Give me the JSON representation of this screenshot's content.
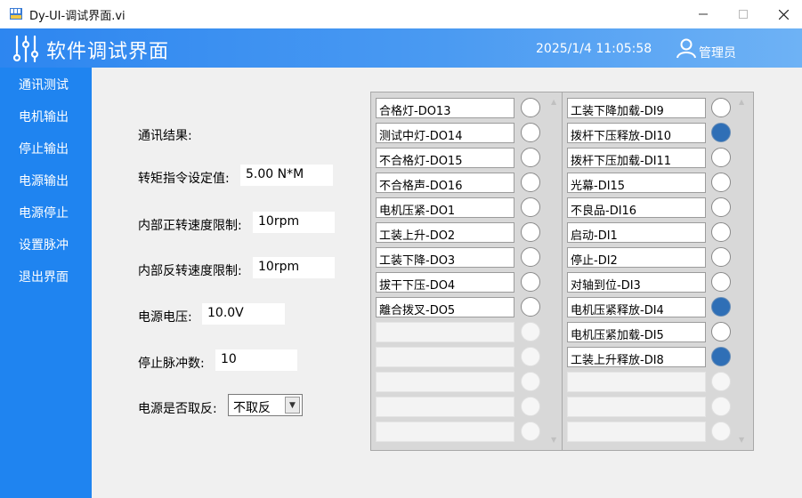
{
  "window": {
    "title": "Dy-UI-调试界面.vi"
  },
  "header": {
    "app_title": "软件调试界面",
    "datetime": "2025/1/4 11:05:58",
    "user": "管理员"
  },
  "sidebar": {
    "items": [
      "通讯测试",
      "电机输出",
      "停止输出",
      "电源输出",
      "电源停止",
      "设置脉冲",
      "退出界面"
    ]
  },
  "form": {
    "comm_result_label": "通讯结果:",
    "torque_label": "转矩指令设定值:",
    "torque_value": "5.00 N*M",
    "fwd_speed_label": "内部正转速度限制:",
    "fwd_speed_value": "10rpm",
    "rev_speed_label": "内部反转速度限制:",
    "rev_speed_value": "10rpm",
    "voltage_label": "电源电压:",
    "voltage_value": "10.0V",
    "pulse_label": "停止脉冲数:",
    "pulse_value": "10",
    "invert_label": "电源是否取反:",
    "invert_value": "不取反"
  },
  "outputs": {
    "items": [
      {
        "label": "合格灯-DO13",
        "on": false
      },
      {
        "label": "测试中灯-DO14",
        "on": false
      },
      {
        "label": "不合格灯-DO15",
        "on": false
      },
      {
        "label": "不合格声-DO16",
        "on": false
      },
      {
        "label": "电机压紧-DO1",
        "on": false
      },
      {
        "label": "工装上升-DO2",
        "on": false
      },
      {
        "label": "工装下降-DO3",
        "on": false
      },
      {
        "label": "拔干下压-DO4",
        "on": false
      },
      {
        "label": "離合拨叉-DO5",
        "on": false
      },
      {
        "label": "",
        "on": false
      },
      {
        "label": "",
        "on": false
      },
      {
        "label": "",
        "on": false
      },
      {
        "label": "",
        "on": false
      },
      {
        "label": "",
        "on": false
      }
    ]
  },
  "inputs": {
    "items": [
      {
        "label": "工装下降加载-DI9",
        "on": false
      },
      {
        "label": "拨杆下压释放-DI10",
        "on": true
      },
      {
        "label": "拨杆下压加载-DI11",
        "on": false
      },
      {
        "label": "光幕-DI15",
        "on": false
      },
      {
        "label": "不良品-DI16",
        "on": false
      },
      {
        "label": "启动-DI1",
        "on": false
      },
      {
        "label": "停止-DI2",
        "on": false
      },
      {
        "label": "对轴到位-DI3",
        "on": false
      },
      {
        "label": "电机压紧释放-DI4",
        "on": true
      },
      {
        "label": "电机压紧加载-DI5",
        "on": false
      },
      {
        "label": "工装上升释放-DI8",
        "on": true
      },
      {
        "label": "",
        "on": false
      },
      {
        "label": "",
        "on": false
      },
      {
        "label": "",
        "on": false
      }
    ]
  },
  "colors": {
    "header": "#2d86f0",
    "sidebar": "#1f84f0",
    "led_on": "#2f6fb6"
  }
}
